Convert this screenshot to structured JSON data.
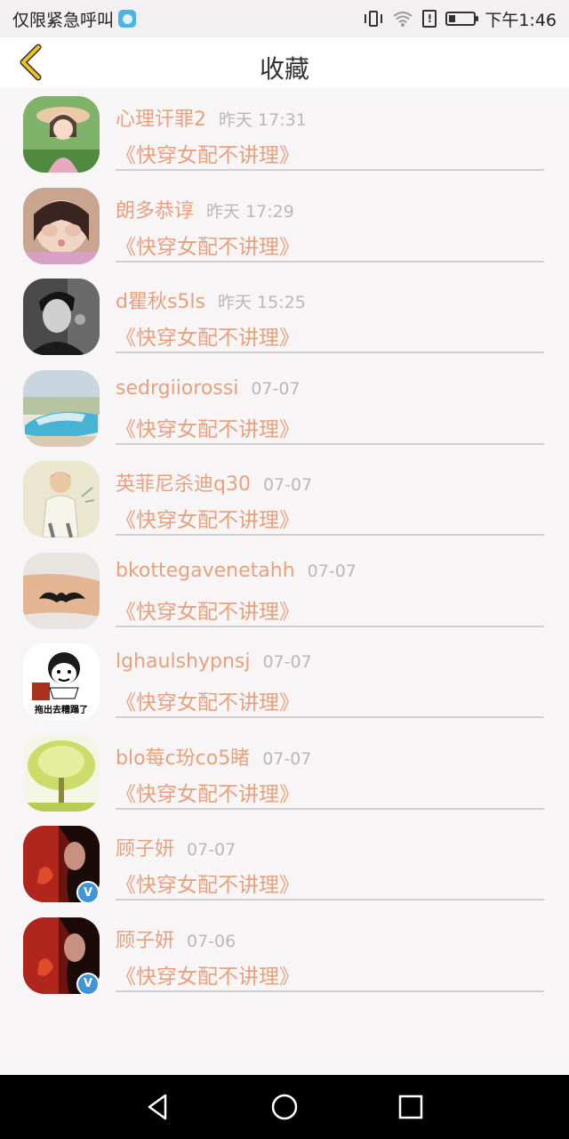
{
  "status_bar": {
    "left_text": "仅限紧急呼叫",
    "time": "下午1:46",
    "battery_level": 0.25,
    "icons": [
      "app-notification-icon",
      "vibrate-icon",
      "wifi-icon",
      "sim-alert-icon",
      "battery-icon"
    ]
  },
  "header": {
    "title": "收藏",
    "back_icon": "chevron-left-icon",
    "accent": "#f0c020"
  },
  "colors": {
    "name": "#e8a07d",
    "time": "#b8b8b8",
    "divider": "#d0d0d0",
    "verified": "#3f95d8"
  },
  "items": [
    {
      "name": "心理讦罪2",
      "time": "昨天 17:31",
      "book": "《快穿女配不讲理》",
      "verified": false
    },
    {
      "name": "朗多恭谆",
      "time": "昨天 17:29",
      "book": "《快穿女配不讲理》",
      "verified": false
    },
    {
      "name": "d瞿秋s5ls",
      "time": "昨天 15:25",
      "book": "《快穿女配不讲理》",
      "verified": false
    },
    {
      "name": "sedrgiiorossi",
      "time": "07-07",
      "book": "《快穿女配不讲理》",
      "verified": false
    },
    {
      "name": "英菲尼杀迪q30",
      "time": "07-07",
      "book": "《快穿女配不讲理》",
      "verified": false
    },
    {
      "name": "bkottegavenetahh",
      "time": "07-07",
      "book": "《快穿女配不讲理》",
      "verified": false
    },
    {
      "name": "lghaulshypnsj",
      "time": "07-07",
      "book": "《快穿女配不讲理》",
      "verified": false,
      "avatar_text": "拖出去糟蹋了"
    },
    {
      "name": "blo莓c玢co5睹",
      "time": "07-07",
      "book": "《快穿女配不讲理》",
      "verified": false
    },
    {
      "name": "顾子妍",
      "time": "07-07",
      "book": "《快穿女配不讲理》",
      "verified": true,
      "badge": "V"
    },
    {
      "name": "顾子妍",
      "time": "07-06",
      "book": "《快穿女配不讲理》",
      "verified": true,
      "badge": "V"
    }
  ],
  "nav": {
    "icons": [
      "back-triangle-icon",
      "home-circle-icon",
      "recents-square-icon"
    ]
  }
}
